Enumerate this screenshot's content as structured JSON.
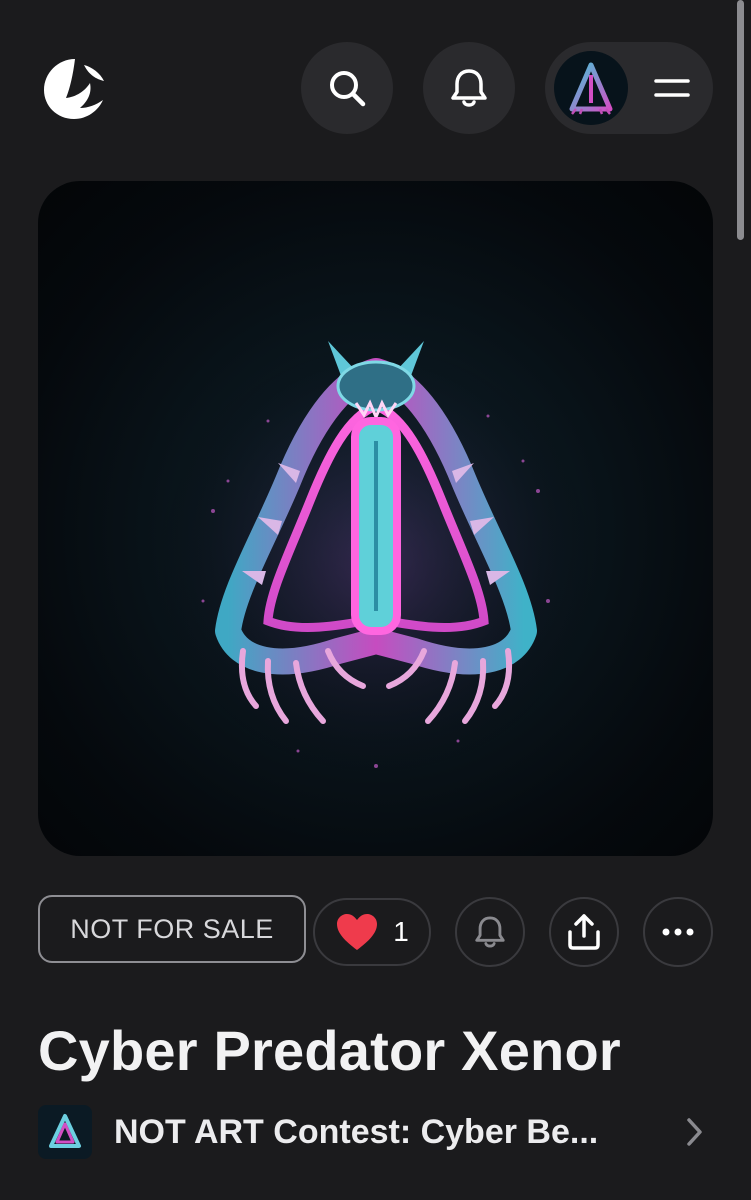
{
  "header": {
    "logo_icon": "app-logo-icon",
    "search_icon": "search-icon",
    "notifications_icon": "bell-icon",
    "menu_icon": "hamburger-icon"
  },
  "artwork": {
    "title": "Cyber Predator Xenor",
    "image": "cyber-creature-artwork"
  },
  "actions": {
    "sale_status": "NOT FOR SALE",
    "like_count": "1",
    "like_icon": "heart-icon",
    "notify_icon": "bell-icon",
    "share_icon": "share-icon",
    "more_icon": "more-icon"
  },
  "collection": {
    "name": "NOT ART Contest: Cyber Be...",
    "chevron_icon": "chevron-right-icon"
  },
  "colors": {
    "background": "#1b1b1d",
    "button_bg": "#2a2a2d",
    "heart": "#ef3b4c",
    "text": "#f2f2f3"
  }
}
